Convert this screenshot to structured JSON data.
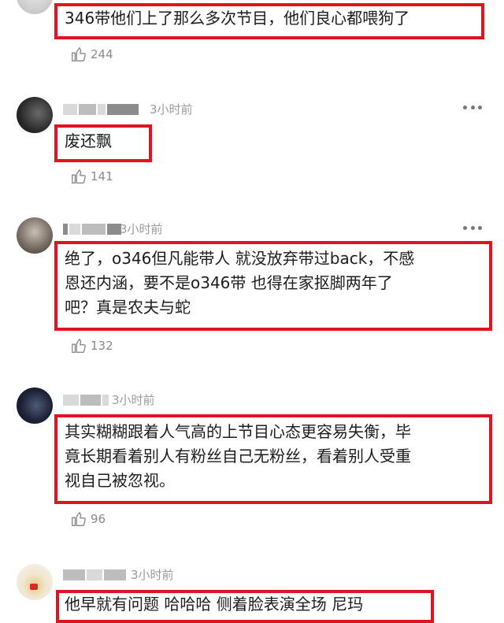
{
  "comments": [
    {
      "text": "346带他们上了那么多次节目，他们良心都喂狗了",
      "likes": "244"
    },
    {
      "time": "3小时前",
      "text": "废还飘",
      "likes": "141"
    },
    {
      "time": "3小时前",
      "text": "绝了，o346但凡能带人 就没放弃带过back，不感\n恩还内涵，要不是o346带 也得在家抠脚两年了\n吧？真是农夫与蛇",
      "likes": "132"
    },
    {
      "time": "3小时前",
      "text": "其实糊糊跟着人气高的上节目心态更容易失衡，毕\n竟长期看着别人有粉丝自己无粉丝，看着别人受重\n视自己被忽视。",
      "likes": "96"
    },
    {
      "time": "3小时前",
      "text": "他早就有问题 哈哈哈 侧着脸表演全场 尼玛"
    }
  ],
  "icons": {
    "like": "thumbs-up-icon",
    "more": "more-dots-icon"
  },
  "colors": {
    "highlight_box": "#e0141e",
    "meta_text": "#9a9a9a"
  }
}
